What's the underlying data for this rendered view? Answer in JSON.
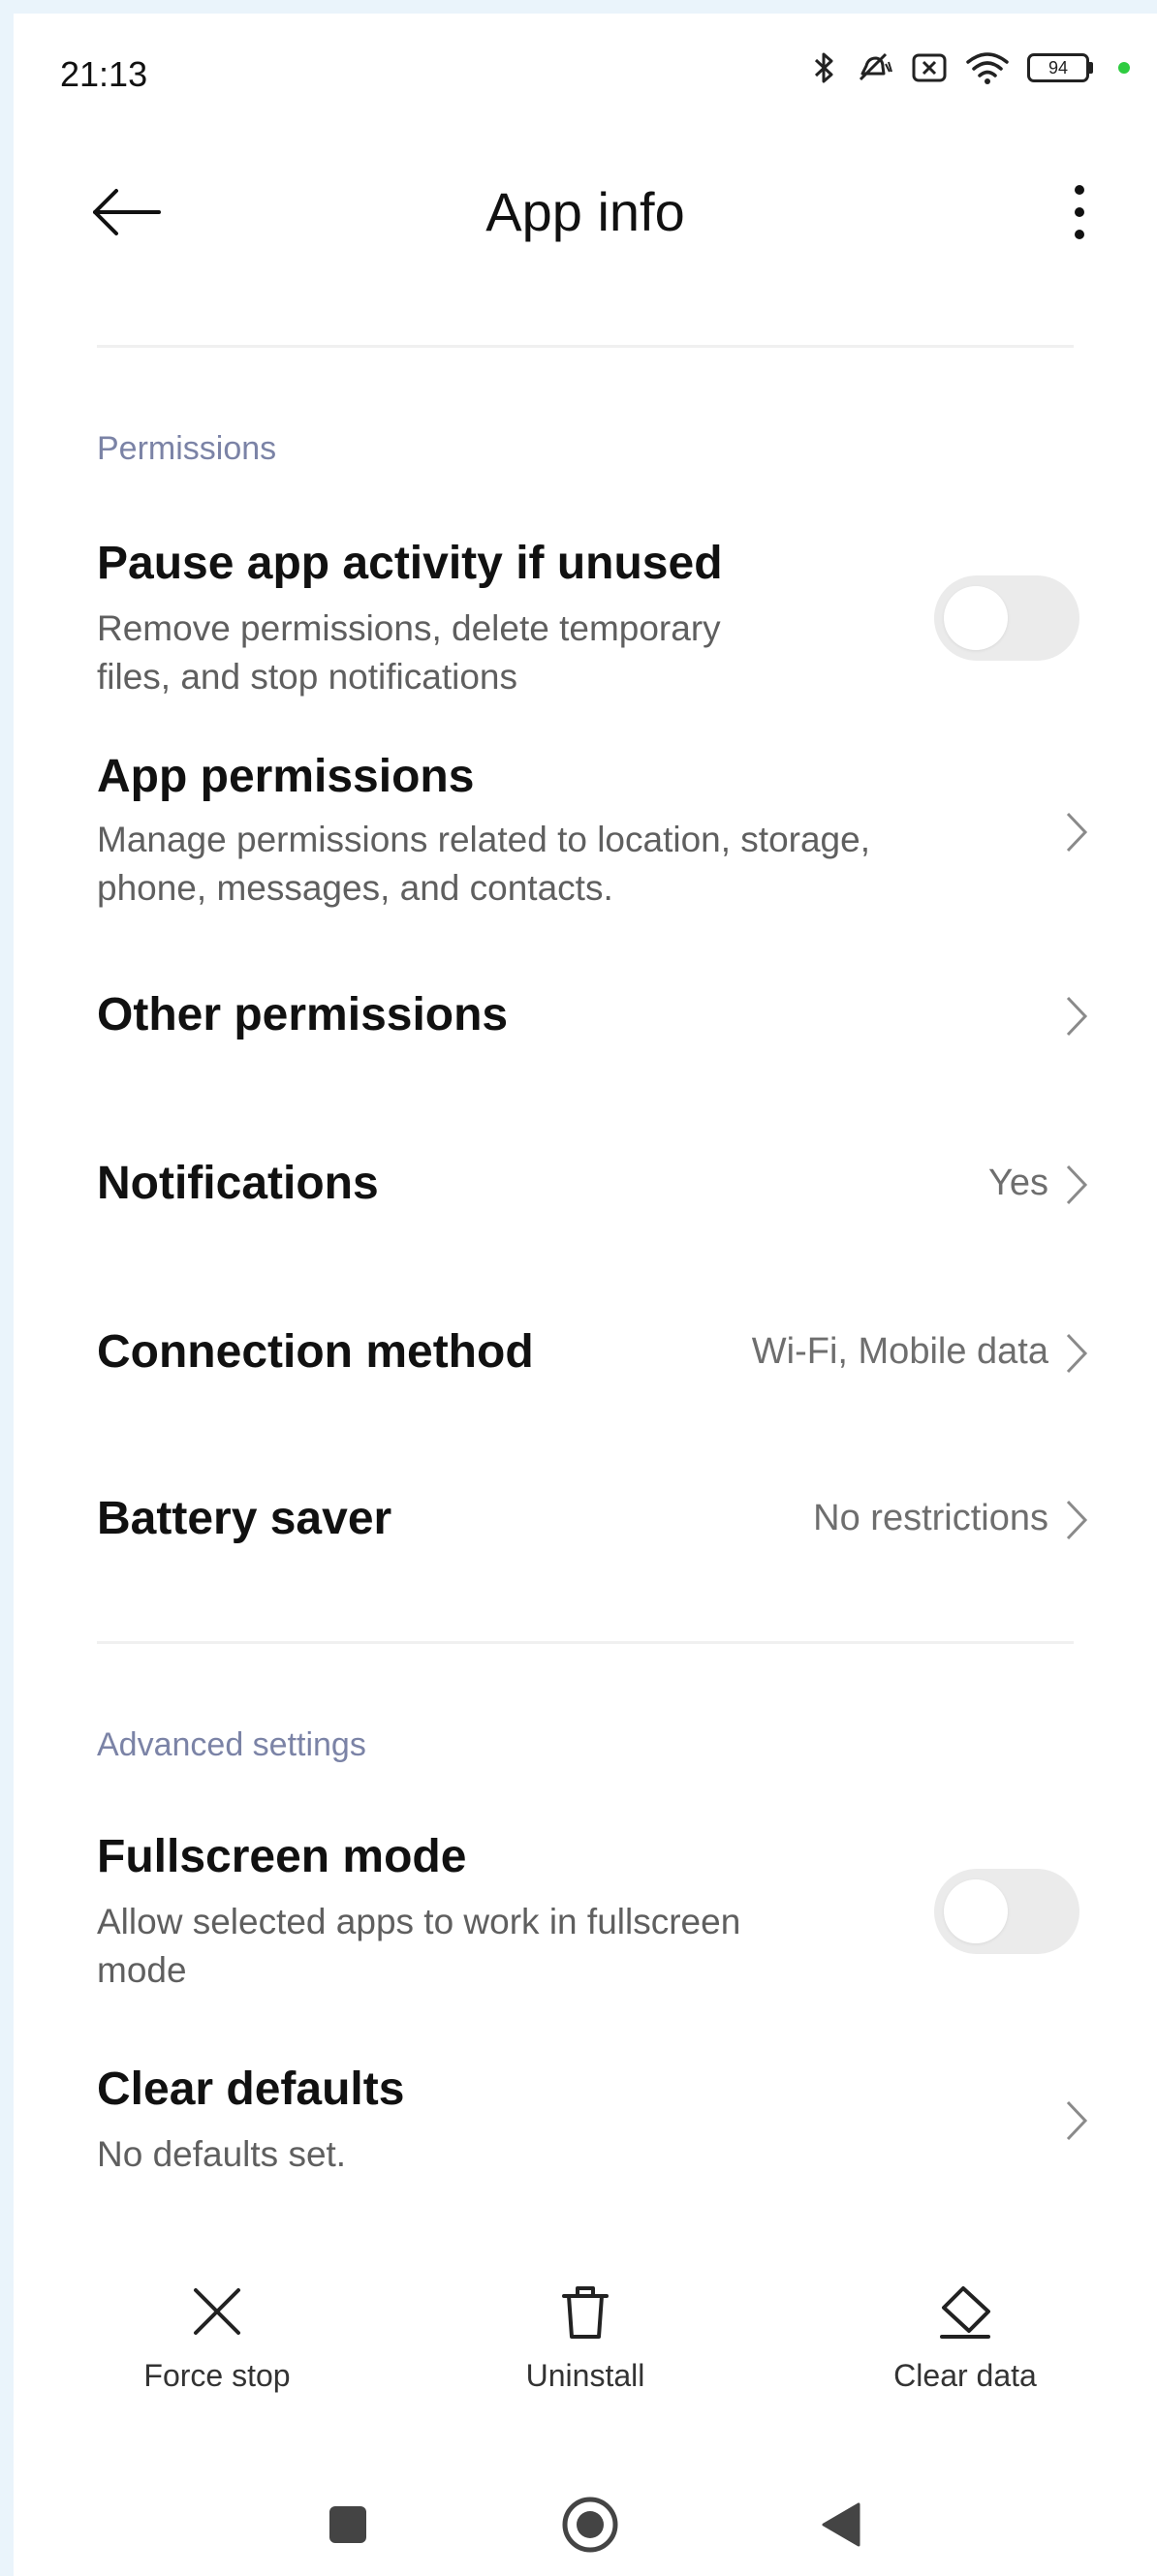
{
  "status_bar": {
    "time": "21:13",
    "battery_level": "94",
    "icons": [
      "bluetooth-icon",
      "mute-icon",
      "no-sim-icon",
      "wifi-icon",
      "battery-icon",
      "charging-dot"
    ],
    "charge_color": "#2ecc40"
  },
  "header": {
    "title": "App info",
    "back_icon": "arrow-left-icon",
    "more_icon": "more-vertical-icon"
  },
  "permissions": {
    "section_label": "Permissions",
    "pause_activity": {
      "title": "Pause app activity if unused",
      "subtitle_line1": "Remove permissions, delete temporary",
      "subtitle_line2": "files, and stop notifications",
      "enabled": false
    },
    "app_permissions": {
      "title": "App permissions",
      "subtitle_line1": "Manage permissions related to location, storage,",
      "subtitle_line2": "phone, messages, and contacts."
    },
    "other_permissions": {
      "title": "Other permissions"
    },
    "notifications": {
      "title": "Notifications",
      "value": "Yes"
    },
    "connection_method": {
      "title": "Connection method",
      "value": "Wi-Fi, Mobile data"
    },
    "battery_saver": {
      "title": "Battery saver",
      "value": "No restrictions"
    }
  },
  "advanced": {
    "section_label": "Advanced settings",
    "fullscreen_mode": {
      "title": "Fullscreen mode",
      "subtitle_line1": "Allow selected apps to work in fullscreen",
      "subtitle_line2": "mode",
      "enabled": false
    },
    "clear_defaults": {
      "title": "Clear defaults",
      "subtitle": "No defaults set."
    }
  },
  "actions": {
    "force_stop": "Force stop",
    "uninstall": "Uninstall",
    "clear_data": "Clear data"
  },
  "colors": {
    "section_header": "#7b83a6",
    "toggle_off": "#ebebeb",
    "frame": "#eaf4fb"
  }
}
